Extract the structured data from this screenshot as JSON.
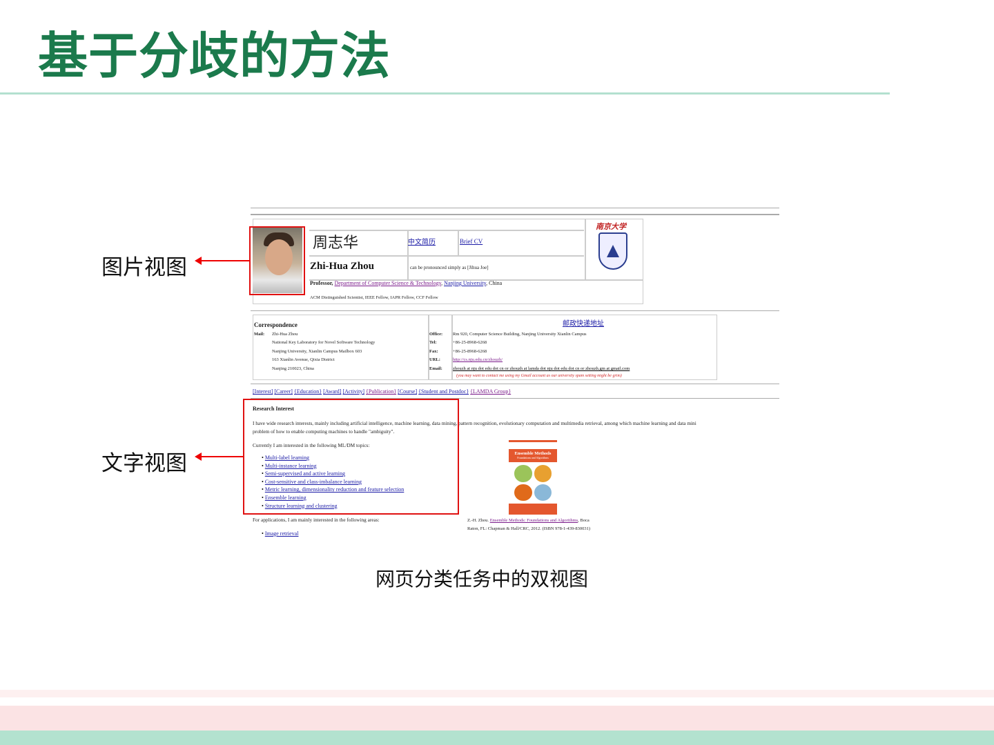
{
  "slide": {
    "title": "基于分歧的方法",
    "image_view_label": "图片视图",
    "text_view_label": "文字视图",
    "caption": "网页分类任务中的双视图"
  },
  "webpage": {
    "name_cn": "周志华",
    "cn_cv": "中文简历",
    "brief_cv": "Brief CV",
    "name_en": "Zhi-Hua Zhou",
    "pronounce": "can be pronounced simply as [Jihua Joe]",
    "university_logo_text": "南京大学",
    "professor": "Professor,",
    "dept": "Department of Computer Science & Technology",
    "univ": "Nanjing University",
    "country": ", China",
    "fellow": "ACM Distinguished Scientist, IEEE Fellow, IAPR Fellow, CCF Fellow",
    "correspondence": "Correspondence",
    "postal_link": "邮政快递地址",
    "mail_label": "Mail:",
    "mail_lines": [
      "Zhi-Hua Zhou",
      "National Key Laboratory for Novel Software Technology",
      "Nanjing University, Xianlin Campus Mailbox 603",
      "163 Xianlin Avenue, Qixia District",
      "Nanjing 210023, China"
    ],
    "office_label": "Office:",
    "office": "Rm 920, Computer Science Building, Nanjing University Xianlin Campus",
    "tel_label": "Tel:",
    "tel": "+86-25-8968-6268",
    "fax_label": "Fax:",
    "fax": "+86-25-8968-6268",
    "url_label": "URL:",
    "url": "http://cs.nju.edu.cn/zhouzh/",
    "email_label": "Email:",
    "email": "zhouzh at nju dot edu dot cn  or  zhouzh at lamda dot nju dot edu dot cn or zhouzh.gm at gmail.com",
    "email_note": "(you may want to contact me using my Gmail account as our university spam setting might be grim)",
    "nav": [
      "[Interest]",
      "[Career]",
      "{Education}",
      "[Award]",
      "[Activity]",
      "{Publication}",
      "[Course]",
      "{Student and Postdoc}",
      "{LAMDA Group}"
    ],
    "research_title": "Research Interest",
    "research_p1": "I have wide research interests, mainly including artificial intelligence, machine learning, data mining, pattern recognition, evolutionary computation and multimedia retrieval, among which machine learning and data mini",
    "research_p2": "problem of how to enable computing machines to handle \"ambiguity\".",
    "topics_intro": "Currently I am interested in the following ML/DM topics:",
    "topics": [
      "Multi-label learning",
      "Multi-instance learning",
      "Semi-supervised and active learning",
      "Cost-sensitive and class-imbalance learning",
      "Metric learning, dimensionality reduction and feature selection",
      "Ensemble learning",
      "Structure learning and clustering"
    ],
    "apps_intro": "For applications, I am mainly interested in the following areas:",
    "apps": [
      "Image retrieval"
    ],
    "book_title": "Ensemble Methods",
    "book_subtitle": "Foundations and Algorithms",
    "book_ref_pre": "Z.-H. Zhou.",
    "book_ref_link": "Ensemble Methods: Foundations and Algorithms",
    "book_ref_post": ", Boca",
    "book_ref_line2": "Raton, FL: Chapman & Hall/CRC, 2012. (ISBN 978-1-439-830031)"
  },
  "colors": {
    "title": "#1b7a4c",
    "accent_line": "#b3e0cf",
    "highlight": "#e01010",
    "footer_pink": "#fbe3e4",
    "footer_green": "#b3e2cf"
  }
}
